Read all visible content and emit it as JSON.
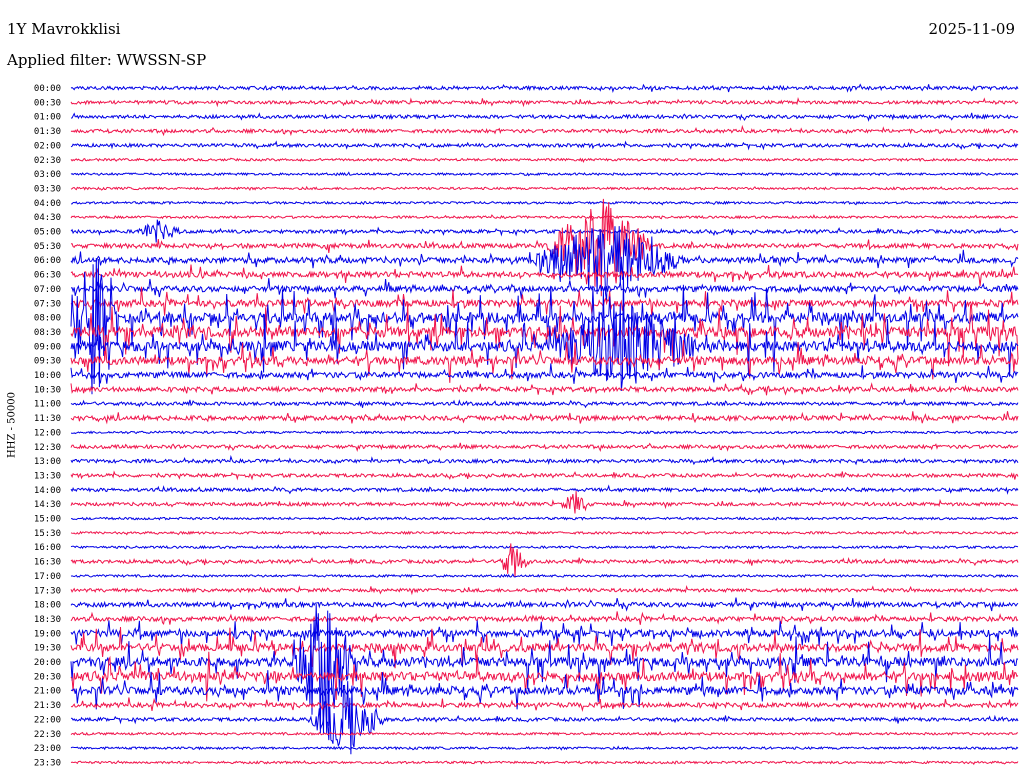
{
  "header": {
    "station": "1Y Mavrokklisi",
    "date": "2025-11-09",
    "filter": "Applied filter: WWSSN-SP"
  },
  "ylabel": "HHZ - 50000",
  "colors": {
    "even": "#0000e6",
    "odd": "#f0144b"
  },
  "chart_data": {
    "type": "line",
    "title": "",
    "xlabel": "",
    "ylabel": "HHZ - 50000",
    "x_unit": "minutes within half-hour (0–30)",
    "row_labels": [
      "00:00",
      "00:30",
      "01:00",
      "01:30",
      "02:00",
      "02:30",
      "03:00",
      "03:30",
      "04:00",
      "04:30",
      "05:00",
      "05:30",
      "06:00",
      "06:30",
      "07:00",
      "07:30",
      "08:00",
      "08:30",
      "09:00",
      "09:30",
      "10:00",
      "10:30",
      "11:00",
      "11:30",
      "12:00",
      "12:30",
      "13:00",
      "13:30",
      "14:00",
      "14:30",
      "15:00",
      "15:30",
      "16:00",
      "16:30",
      "17:00",
      "17:30",
      "18:00",
      "18:30",
      "19:00",
      "19:30",
      "20:00",
      "20:30",
      "21:00",
      "21:30",
      "22:00",
      "22:30",
      "23:00",
      "23:30"
    ],
    "series_colors": [
      "#0000e6",
      "#f0144b"
    ],
    "relative_activity": [
      2,
      2,
      2,
      2,
      2,
      1,
      1,
      1,
      1,
      1,
      2,
      3,
      4,
      4,
      4,
      5,
      8,
      8,
      8,
      6,
      4,
      3,
      2,
      3,
      1,
      2,
      2,
      2,
      2,
      2,
      1,
      1,
      1,
      2,
      1,
      2,
      3,
      3,
      5,
      6,
      7,
      7,
      6,
      3,
      2,
      1,
      1,
      1
    ],
    "events": [
      {
        "row": "05:00",
        "minute_start": 2.0,
        "minute_end": 3.5,
        "amplitude": 0.8
      },
      {
        "row": "05:30",
        "minute_start": 15.0,
        "minute_end": 18.5,
        "amplitude": 4.0
      },
      {
        "row": "06:00",
        "minute_start": 14.5,
        "minute_end": 19.5,
        "amplitude": 3.0
      },
      {
        "row": "08:00",
        "minute_start": 0.0,
        "minute_end": 1.5,
        "amplitude": 5.0
      },
      {
        "row": "09:00",
        "minute_start": 15.0,
        "minute_end": 20.0,
        "amplitude": 3.5
      },
      {
        "row": "14:30",
        "minute_start": 15.5,
        "minute_end": 16.5,
        "amplitude": 0.9
      },
      {
        "row": "16:30",
        "minute_start": 13.5,
        "minute_end": 14.5,
        "amplitude": 1.5
      },
      {
        "row": "20:00",
        "minute_start": 7.0,
        "minute_end": 9.0,
        "amplitude": 6.0
      },
      {
        "row": "22:00",
        "minute_start": 7.5,
        "minute_end": 10.0,
        "amplitude": 3.0
      }
    ]
  }
}
